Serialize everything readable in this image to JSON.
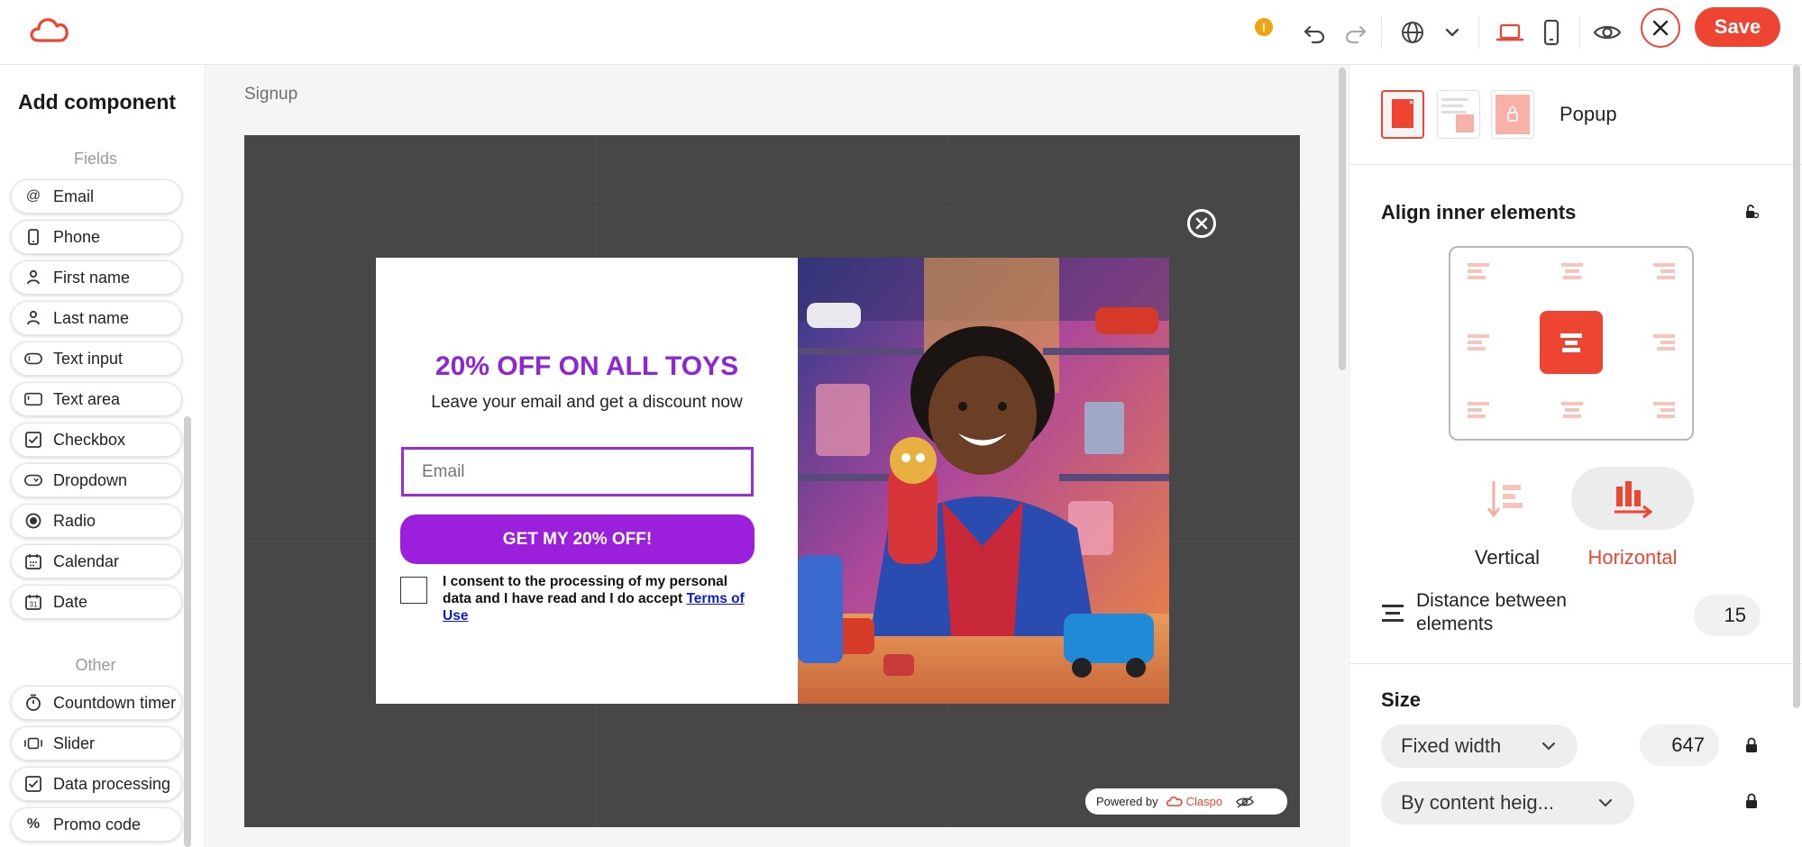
{
  "header": {
    "logo_name": "claspo-cloud-logo",
    "warning_badge": "!",
    "save_label": "Save"
  },
  "left_panel": {
    "title": "Add component",
    "fields_label": "Fields",
    "fields": [
      {
        "label": "Email",
        "icon": "at-icon"
      },
      {
        "label": "Phone",
        "icon": "phone-icon"
      },
      {
        "label": "First name",
        "icon": "person-icon"
      },
      {
        "label": "Last name",
        "icon": "person-icon"
      },
      {
        "label": "Text input",
        "icon": "text-input-icon"
      },
      {
        "label": "Text area",
        "icon": "text-area-icon"
      },
      {
        "label": "Checkbox",
        "icon": "checkbox-icon"
      },
      {
        "label": "Dropdown",
        "icon": "dropdown-icon"
      },
      {
        "label": "Radio",
        "icon": "radio-icon"
      },
      {
        "label": "Calendar",
        "icon": "calendar-icon"
      },
      {
        "label": "Date",
        "icon": "date-icon"
      }
    ],
    "other_label": "Other",
    "other": [
      {
        "label": "Countdown timer",
        "icon": "stopwatch-icon"
      },
      {
        "label": "Slider",
        "icon": "slider-icon"
      },
      {
        "label": "Data processing",
        "icon": "checkbox-icon"
      },
      {
        "label": "Promo code",
        "icon": "percent-icon"
      }
    ]
  },
  "canvas": {
    "breadcrumb": "Signup",
    "popup": {
      "title": "20% OFF ON ALL TOYS",
      "subtitle": "Leave your email and get a discount now",
      "email_placeholder": "Email",
      "cta_label": "GET MY 20% OFF!",
      "consent_text": "I consent to the processing of my personal data and I have read and I do accept ",
      "consent_link": "Terms of Use"
    },
    "powered_by": "Powered by",
    "powered_brand": "Claspo"
  },
  "right_panel": {
    "widget_type": "Popup",
    "align_heading": "Align inner elements",
    "direction_options": [
      "Vertical",
      "Horizontal"
    ],
    "direction_selected": "Horizontal",
    "distance_label": "Distance between elements",
    "distance_value": "15",
    "size_heading": "Size",
    "width_mode": "Fixed width",
    "width_value": "647",
    "height_mode": "By content heig..."
  },
  "colors": {
    "accent": "#ee4532",
    "popup_purple": "#9b1fdc",
    "stage_bg": "#474747"
  }
}
